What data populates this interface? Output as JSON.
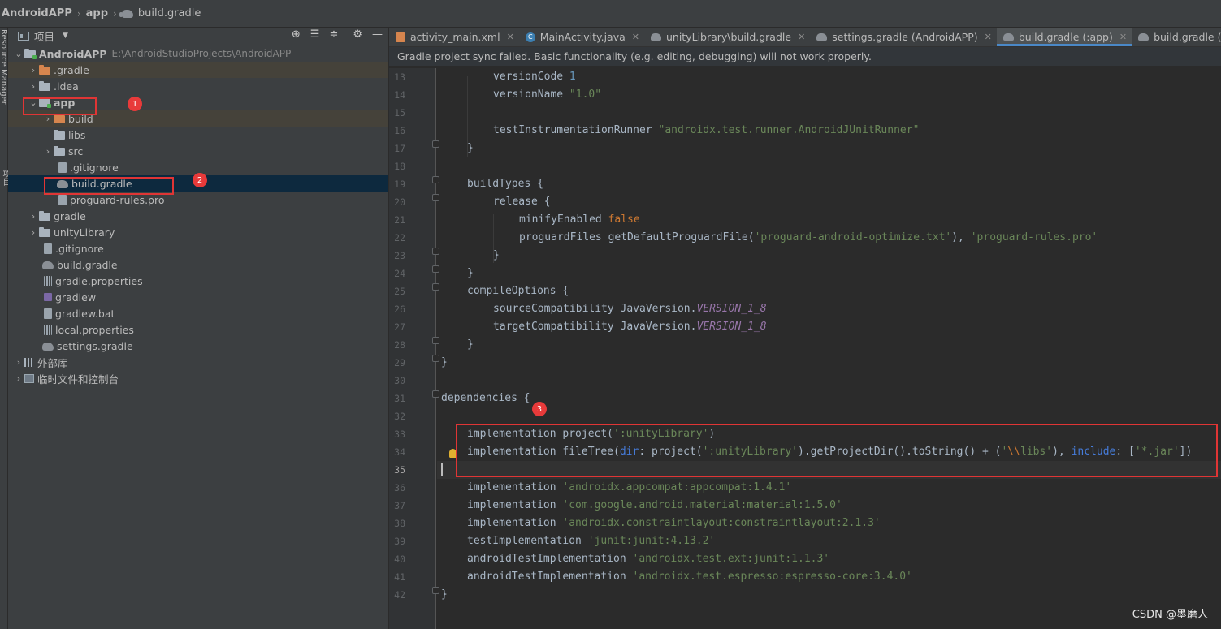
{
  "breadcrumb": {
    "project": "AndroidAPP",
    "module": "app",
    "file": "build.gradle"
  },
  "left_strip": {
    "resource_manager": "Resource Manager",
    "project_tab": "项目"
  },
  "project_panel": {
    "title": "项目",
    "tree": [
      {
        "name": "AndroidAPP",
        "path": "E:\\AndroidStudioProjects\\AndroidAPP"
      },
      {
        "name": ".gradle"
      },
      {
        "name": ".idea"
      },
      {
        "name": "app"
      },
      {
        "name": "build"
      },
      {
        "name": "libs"
      },
      {
        "name": "src"
      },
      {
        "name": ".gitignore"
      },
      {
        "name": "build.gradle"
      },
      {
        "name": "proguard-rules.pro"
      },
      {
        "name": "gradle"
      },
      {
        "name": "unityLibrary"
      },
      {
        "name": ".gitignore"
      },
      {
        "name": "build.gradle"
      },
      {
        "name": "gradle.properties"
      },
      {
        "name": "gradlew"
      },
      {
        "name": "gradlew.bat"
      },
      {
        "name": "local.properties"
      },
      {
        "name": "settings.gradle"
      },
      {
        "name": "外部库"
      },
      {
        "name": "临时文件和控制台"
      }
    ]
  },
  "annotations": {
    "badge1": "1",
    "badge2": "2",
    "badge3": "3"
  },
  "tabs": [
    {
      "label": "activity_main.xml"
    },
    {
      "label": "MainActivity.java"
    },
    {
      "label": "unityLibrary\\build.gradle"
    },
    {
      "label": "settings.gradle (AndroidAPP)"
    },
    {
      "label": "build.gradle (:app)"
    },
    {
      "label": "build.gradle (AndroidAP"
    }
  ],
  "notification": "Gradle project sync failed. Basic functionality (e.g. editing, debugging) will not work properly.",
  "line_numbers": [
    "13",
    "14",
    "15",
    "16",
    "17",
    "18",
    "19",
    "20",
    "21",
    "22",
    "23",
    "24",
    "25",
    "26",
    "27",
    "28",
    "29",
    "30",
    "31",
    "32",
    "33",
    "34",
    "35",
    "36",
    "37",
    "38",
    "39",
    "40",
    "41",
    "42"
  ],
  "code": {
    "l13": {
      "a": "versionCode ",
      "b": "1"
    },
    "l14": {
      "a": "versionName ",
      "b": "\"1.0\""
    },
    "l16": {
      "a": "testInstrumentationRunner ",
      "b": "\"androidx.test.runner.AndroidJUnitRunner\""
    },
    "l17": "}",
    "l19": "buildTypes {",
    "l20": "release {",
    "l21": {
      "a": "minifyEnabled ",
      "b": "false"
    },
    "l22": {
      "a": "proguardFiles getDefaultProguardFile(",
      "b": "'proguard-android-optimize.txt'",
      "c": "), ",
      "d": "'proguard-rules.pro'"
    },
    "l23": "}",
    "l24": "}",
    "l25": "compileOptions {",
    "l26": {
      "a": "sourceCompatibility JavaVersion.",
      "b": "VERSION_1_8"
    },
    "l27": {
      "a": "targetCompatibility JavaVersion.",
      "b": "VERSION_1_8"
    },
    "l28": "}",
    "l29": "}",
    "l31": "dependencies {",
    "l33": {
      "a": "implementation project(",
      "b": "':unityLibrary'",
      "c": ")"
    },
    "l34": {
      "a": "implementation fileTree(",
      "b": "dir",
      "c": ": project(",
      "d": "':unityLibrary'",
      "e": ").getProjectDir().toString() + (",
      "f": "'",
      "g": "\\\\",
      "h": "libs'",
      "i": "), ",
      "j": "include",
      "k": ": [",
      "l": "'*.jar'",
      "m": "])"
    },
    "l36": {
      "a": "implementation ",
      "b": "'androidx.appcompat:appcompat:1.4.1'"
    },
    "l37": {
      "a": "implementation ",
      "b": "'com.google.android.material:material:1.5.0'"
    },
    "l38": {
      "a": "implementation ",
      "b": "'androidx.constraintlayout:constraintlayout:2.1.3'"
    },
    "l39": {
      "a": "testImplementation ",
      "b": "'junit:junit:4.13.2'"
    },
    "l40": {
      "a": "androidTestImplementation ",
      "b": "'androidx.test.ext:junit:1.1.3'"
    },
    "l41": {
      "a": "androidTestImplementation ",
      "b": "'androidx.test.espresso:espresso-core:3.4.0'"
    },
    "l42": "}"
  },
  "watermark": "CSDN @墨磨人"
}
